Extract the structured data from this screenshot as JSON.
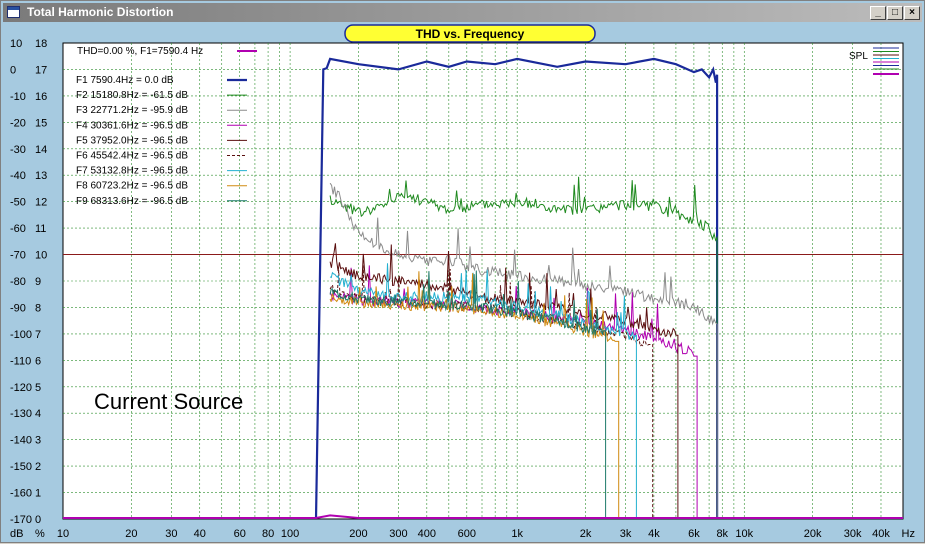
{
  "window": {
    "title": "Total Harmonic Distortion",
    "buttons": {
      "minimize": "_",
      "maximize": "□",
      "close": "×"
    }
  },
  "chart_data": {
    "type": "line",
    "title": "THD vs. Frequency",
    "annotation": "Current Source",
    "thd_readout": "THD=0.00 %, F1=7590.4 Hz",
    "right_legend": "SPL",
    "x_scale": "log",
    "xlim": [
      10,
      50000
    ],
    "ylim": [
      -170,
      10
    ],
    "xlabel": "Hz",
    "x_ticks": [
      {
        "v": 10,
        "label": "10"
      },
      {
        "v": 20,
        "label": "20"
      },
      {
        "v": 30,
        "label": "30"
      },
      {
        "v": 40,
        "label": "40"
      },
      {
        "v": 60,
        "label": "60"
      },
      {
        "v": 80,
        "label": "80"
      },
      {
        "v": 100,
        "label": "100"
      },
      {
        "v": 200,
        "label": "200"
      },
      {
        "v": 300,
        "label": "300"
      },
      {
        "v": 400,
        "label": "400"
      },
      {
        "v": 600,
        "label": "600"
      },
      {
        "v": 1000,
        "label": "1k"
      },
      {
        "v": 2000,
        "label": "2k"
      },
      {
        "v": 3000,
        "label": "3k"
      },
      {
        "v": 4000,
        "label": "4k"
      },
      {
        "v": 6000,
        "label": "6k"
      },
      {
        "v": 8000,
        "label": "8k"
      },
      {
        "v": 10000,
        "label": "10k"
      },
      {
        "v": 20000,
        "label": "20k"
      },
      {
        "v": 30000,
        "label": "30k"
      },
      {
        "v": 40000,
        "label": "40k"
      }
    ],
    "y_ticks_db": [
      "10",
      "0",
      "-10",
      "-20",
      "-30",
      "-40",
      "-50",
      "-60",
      "-70",
      "-80",
      "-90",
      "-100",
      "-110",
      "-120",
      "-130",
      "-140",
      "-150",
      "-160",
      "-170"
    ],
    "y_ticks_pct": [
      "18",
      "17",
      "16",
      "15",
      "14",
      "13",
      "12",
      "11",
      "10",
      "9",
      "8",
      "7",
      "6",
      "5",
      "4",
      "3",
      "2",
      "1",
      "0"
    ],
    "y_unit_db": "dB",
    "y_unit_pct": "%",
    "reference_line_db": -70,
    "series": [
      {
        "name": "F1 7590.4Hz = 0.0 dB",
        "color": "#1a2a9a",
        "width": 2.2,
        "x": [
          145,
          150,
          200,
          300,
          400,
          500,
          600,
          800,
          1000,
          1500,
          2000,
          3000,
          4000,
          5000,
          6000,
          6500,
          7000,
          7300,
          7500,
          7590
        ],
        "y": [
          0.5,
          4,
          2,
          0,
          3,
          1,
          3,
          2,
          4,
          1,
          3,
          2,
          4,
          2,
          -1,
          0,
          -3,
          0,
          -5,
          -2
        ],
        "cutoff": 7590
      },
      {
        "name": "F2 15180.8Hz = -61.5 dB",
        "color": "#1f8a1f",
        "width": 1,
        "x": [
          150,
          170,
          200,
          250,
          300,
          400,
          500,
          700,
          1000,
          1500,
          2000,
          3000,
          4000,
          5000,
          6000,
          7000,
          7590
        ],
        "y": [
          -49,
          -51,
          -54,
          -52,
          -47,
          -50,
          -53,
          -51,
          -50,
          -53,
          -53,
          -51,
          -52,
          -55,
          -57,
          -60,
          -65
        ],
        "cutoff": 7590
      },
      {
        "name": "F3 22771.2Hz = -95.9 dB",
        "color": "#8c8c8c",
        "width": 1,
        "x": [
          150,
          170,
          200,
          250,
          300,
          400,
          500,
          700,
          1000,
          1500,
          2000,
          3000,
          4000,
          5000,
          6000,
          7000,
          7590
        ],
        "y": [
          -44,
          -50,
          -62,
          -67,
          -70,
          -73,
          -72,
          -76,
          -78,
          -80,
          -82,
          -84,
          -87,
          -88,
          -90,
          -94,
          -96
        ],
        "cutoff": 7590
      },
      {
        "name": "F4 30361.6Hz = -96.5 dB",
        "color": "#b000b0",
        "width": 1,
        "x": [
          150,
          200,
          300,
          500,
          700,
          1000,
          1500,
          2000,
          3000,
          4000,
          5000,
          5500,
          6000
        ],
        "y": [
          -85,
          -87,
          -88,
          -89,
          -90,
          -92,
          -94,
          -96,
          -98,
          -102,
          -105,
          -106,
          -108
        ],
        "cutoff": 6200
      },
      {
        "name": "F5 37952.0Hz = -96.5 dB",
        "color": "#5a0f0f",
        "width": 1,
        "x": [
          150,
          200,
          300,
          500,
          700,
          1000,
          1500,
          2000,
          3000,
          4000,
          5000
        ],
        "y": [
          -73,
          -78,
          -80,
          -83,
          -86,
          -88,
          -90,
          -92,
          -95,
          -98,
          -100
        ],
        "cutoff": 5100
      },
      {
        "name": "F6 45542.4Hz = -96.5 dB",
        "color": "#5a0f0f",
        "dash": "3,2",
        "width": 1,
        "x": [
          150,
          200,
          300,
          500,
          700,
          1000,
          1500,
          2000,
          3000,
          3800
        ],
        "y": [
          -83,
          -86,
          -88,
          -89,
          -90,
          -92,
          -95,
          -97,
          -101,
          -104
        ],
        "cutoff": 3950
      },
      {
        "name": "F7 53132.8Hz = -96.5 dB",
        "color": "#22b0d0",
        "width": 1,
        "x": [
          150,
          200,
          300,
          500,
          700,
          1000,
          1500,
          2000,
          3000,
          3300
        ],
        "y": [
          -78,
          -84,
          -86,
          -86,
          -87,
          -90,
          -93,
          -96,
          -100,
          -101
        ],
        "cutoff": 3350
      },
      {
        "name": "F8 60723.2Hz = -96.5 dB",
        "color": "#d08a10",
        "width": 1,
        "x": [
          150,
          200,
          300,
          500,
          700,
          1000,
          1500,
          2000,
          2700
        ],
        "y": [
          -86,
          -88,
          -89,
          -90,
          -91,
          -93,
          -96,
          -99,
          -102
        ],
        "cutoff": 2800
      },
      {
        "name": "F9 68313.6Hz = -96.5 dB",
        "color": "#1f7a6a",
        "width": 1,
        "x": [
          150,
          200,
          300,
          500,
          700,
          1000,
          1500,
          2000,
          2400
        ],
        "y": [
          -84,
          -87,
          -88,
          -89,
          -90,
          -92,
          -95,
          -98,
          -100
        ],
        "cutoff": 2450
      }
    ],
    "baseline_series": {
      "color": "#b000b0",
      "x": [
        10,
        130,
        150,
        200,
        1000,
        8000,
        50000
      ],
      "y": [
        -170,
        -170,
        -169,
        -170,
        -170,
        -170,
        -170
      ]
    }
  }
}
